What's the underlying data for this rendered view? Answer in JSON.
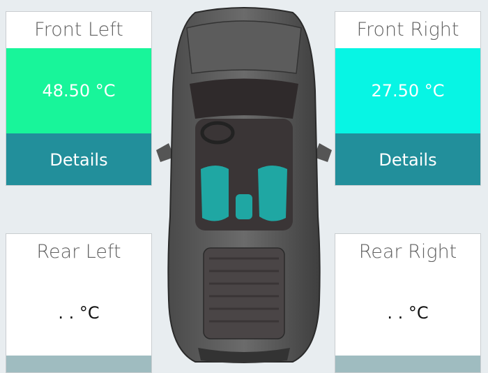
{
  "tires": {
    "front_left": {
      "title": "Front Left",
      "temperature": "48.50 °C",
      "details_label": "Details"
    },
    "front_right": {
      "title": "Front Right",
      "temperature": "27.50 °C",
      "details_label": "Details"
    },
    "rear_left": {
      "title": "Rear Left",
      "temperature": ". . °C"
    },
    "rear_right": {
      "title": "Rear Right",
      "temperature": ". . °C"
    }
  },
  "colors": {
    "background": "#e8edf0",
    "front_left_temp_bg": "#18f59a",
    "front_right_temp_bg": "#07f5e4",
    "details_bg": "#228f9b",
    "rear_details_bg": "#9fbcc0",
    "seat_color": "#1fa7a3"
  }
}
